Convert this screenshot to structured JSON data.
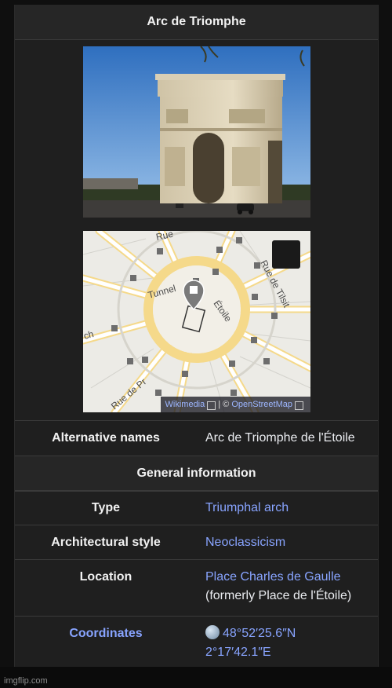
{
  "infobox": {
    "title": "Arc de Triomphe",
    "section_general": "General information",
    "rows": [
      {
        "label": "Alternative names",
        "value": "Arc de Triomphe de l'Étoile"
      },
      {
        "label": "Type",
        "value": "Triumphal arch"
      },
      {
        "label": "Architectural style",
        "value": "Neoclassicism"
      },
      {
        "label": "Location",
        "value_link": "Place Charles de Gaulle",
        "value_note": "(formerly Place de l'Étoile)"
      },
      {
        "label": "Coordinates",
        "lat": "48°52′25.6″N",
        "lon": "2°17′42.1″E"
      }
    ],
    "map": {
      "attribution_source": "Wikimedia",
      "attribution_sep": "| ©",
      "attribution_osm": "OpenStreetMap",
      "street_labels": [
        "Tunnel",
        "Étoile",
        "Rue de Tilsit",
        "Rue de Pr",
        "Rue",
        "ch"
      ]
    },
    "icons": [
      "globe-icon",
      "external-link-icon",
      "map-pin-icon",
      "fullscreen-icon",
      "bus-stop-icon"
    ],
    "colors": {
      "link": "#88a4ff",
      "background": "#1f1f1f",
      "header": "#262626"
    }
  },
  "footer": {
    "watermark": "imgflip.com"
  }
}
